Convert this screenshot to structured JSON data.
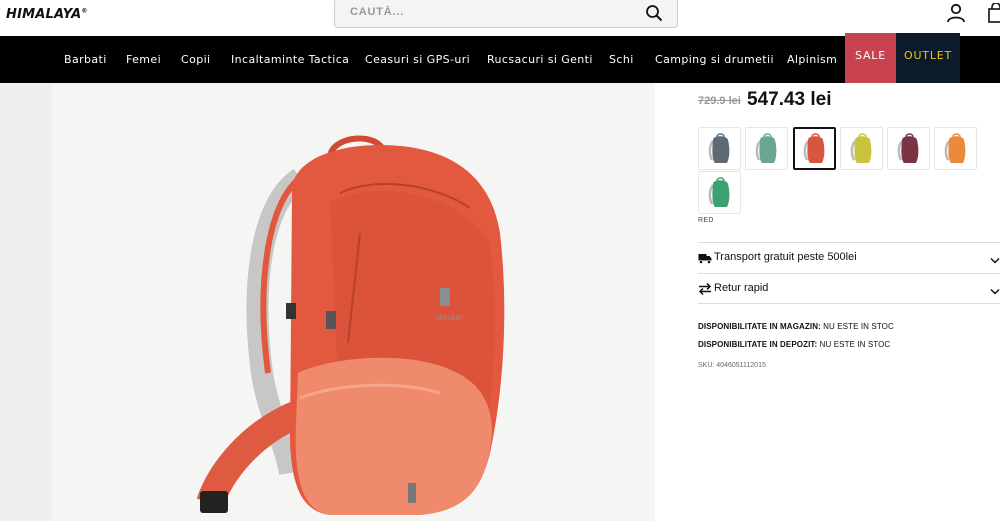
{
  "header": {
    "logo": "HIMALAYA",
    "logo_mark": "®",
    "search_placeholder": "CAUTĂ...",
    "icons": [
      "search-icon",
      "user-icon",
      "cart-icon"
    ]
  },
  "nav": {
    "items": [
      "Barbati",
      "Femei",
      "Copii",
      "Incaltaminte Tactica",
      "Ceasuri si GPS-uri",
      "Rucsacuri si Genti",
      "Schi",
      "Camping si drumetii",
      "Alpinism"
    ],
    "sale": "SALE",
    "outlet": "OUTLET"
  },
  "product": {
    "old_price": "729.9 lei",
    "price": "547.43 lei",
    "color_label": "RED",
    "swatches": [
      {
        "color": "#5e6a75",
        "name": "graphite"
      },
      {
        "color": "#6aa695",
        "name": "jade"
      },
      {
        "color": "#d9563e",
        "name": "red",
        "selected": true
      },
      {
        "color": "#c9c43c",
        "name": "lime"
      },
      {
        "color": "#7a3444",
        "name": "aubergine"
      },
      {
        "color": "#ea8a3a",
        "name": "orange"
      },
      {
        "color": "#3e9f6f",
        "name": "green"
      }
    ],
    "transport": "Transport gratuit peste 500lei",
    "return": "Retur rapid",
    "store_label": "DISPONIBILITATE IN MAGAZIN:",
    "store_value": " NU ESTE IN STOC",
    "depot_label": "DISPONIBILITATE IN DEPOZIT:",
    "depot_value": " NU ESTE IN STOC",
    "sku": "SKU: 4046051112015"
  },
  "colors": {
    "sale_bg": "#c8434f",
    "outlet_bg": "#0c1b2a",
    "outlet_text": "#f3c40f",
    "backpack": "#e2593f"
  }
}
